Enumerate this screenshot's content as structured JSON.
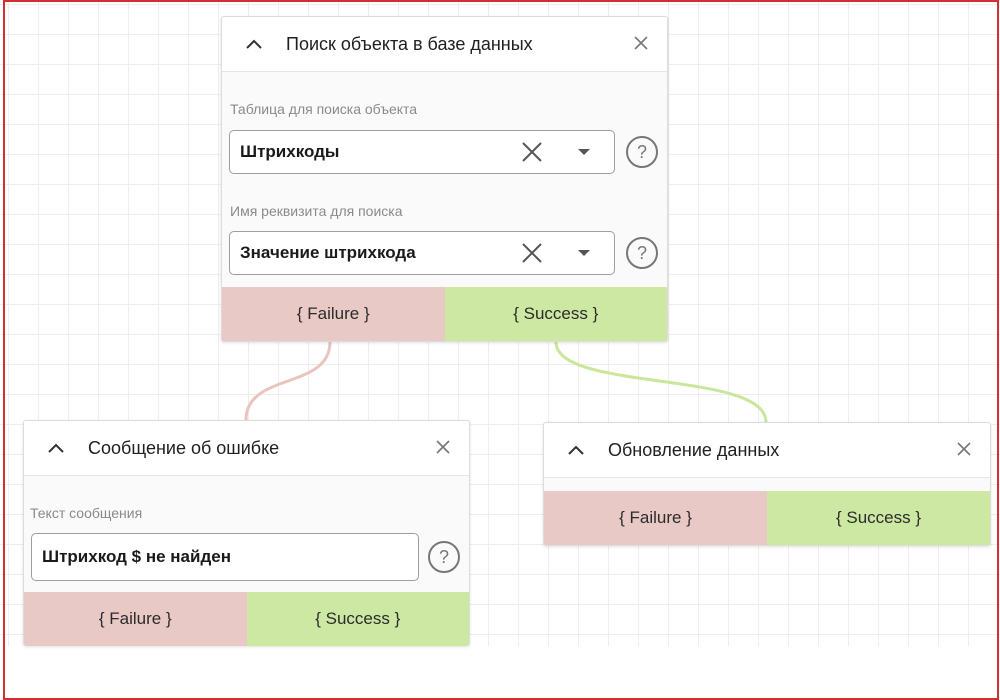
{
  "colors": {
    "frame": "#d32f2f",
    "failure_bg": "#e8c9c5",
    "success_bg": "#cde8a2",
    "failure_line": "#e9c5be",
    "success_line": "#c9e69a"
  },
  "node_search": {
    "title": "Поиск объекта в базе данных",
    "collapse_icon": "chevron-up-icon",
    "close_icon": "close-icon",
    "table_label": "Таблица для поиска объекта",
    "table_value": "Штрихкоды",
    "attr_label": "Имя реквизита для поиска",
    "attr_value": "Значение штрихкода",
    "failure": "{ Failure }",
    "success": "{ Success }"
  },
  "node_error": {
    "title": "Сообщение об ошибке",
    "text_label": "Текст сообщения",
    "text_value": "Штрихкод $ не найден",
    "failure": "{ Failure }",
    "success": "{ Success }"
  },
  "node_update": {
    "title": "Обновление данных",
    "failure": "{ Failure }",
    "success": "{ Success }"
  }
}
